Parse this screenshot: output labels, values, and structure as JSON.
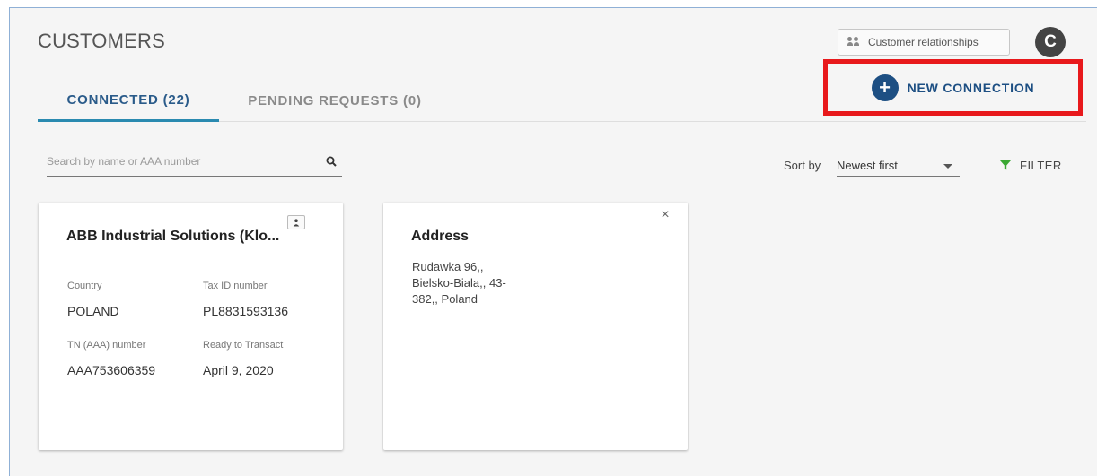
{
  "header": {
    "title": "CUSTOMERS",
    "relationships_label": "Customer relationships",
    "refresh_glyph": "C"
  },
  "tabs": [
    {
      "label": "CONNECTED (22)",
      "active": true
    },
    {
      "label": "PENDING REQUESTS (0)",
      "active": false
    }
  ],
  "new_connection": {
    "label": "NEW CONNECTION",
    "glyph": "+"
  },
  "search": {
    "placeholder": "Search by name or AAA number",
    "value": ""
  },
  "sort": {
    "label": "Sort by",
    "value": "Newest first"
  },
  "filter": {
    "label": "FILTER"
  },
  "customer_card": {
    "name": "ABB Industrial Solutions (Klo...",
    "country_label": "Country",
    "country": "POLAND",
    "tax_label": "Tax ID number",
    "tax": "PL8831593136",
    "tn_label": "TN (AAA) number",
    "tn": "AAA753606359",
    "ready_label": "Ready to Transact",
    "ready": "April 9, 2020"
  },
  "address_card": {
    "title": "Address",
    "lines": [
      "Rudawka 96,,",
      "Bielsko-Biala,, 43-",
      "382,, Poland"
    ],
    "close_glyph": "×"
  },
  "colors": {
    "accent": "#1d4f83",
    "tab_underline": "#2a8ab0",
    "highlight_box": "#e8191c",
    "filter_icon": "#3aa832"
  },
  "icons": [
    "people-icon",
    "refresh-icon",
    "plus-circle-icon",
    "search-icon",
    "chevron-down-icon",
    "filter-icon",
    "person-icon",
    "close-icon"
  ]
}
